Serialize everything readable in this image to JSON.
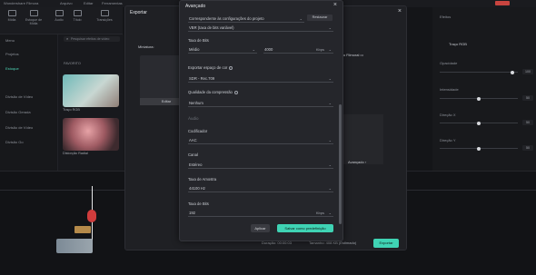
{
  "editor": {
    "menu": [
      "Wondershare Filmora",
      "Arquivo",
      "Editar",
      "Ferramentas"
    ],
    "tools": [
      "Mídia",
      "Estoque de Mídia",
      "Áudio",
      "Título",
      "Transições"
    ],
    "sidebar": [
      "Menu",
      "Projetos",
      "Estoque",
      "Divisão de Vídeo",
      "Divisão Gerada",
      "Divisão de Vídeo",
      "Divisão Go"
    ],
    "media_search_placeholder": "Pesquisar efeitos de vídeo",
    "media_badge": "FAVORITO",
    "thumbs": [
      {
        "label": "Traço RGB"
      },
      {
        "label": "Distorção Radial"
      }
    ],
    "right_panel": {
      "tab": "Efeitos",
      "toggle_label": "Traço RGB",
      "controls": [
        {
          "label": "Opacidade",
          "value": "100",
          "level": 0.95
        },
        {
          "label": "Intensidade",
          "value": "50",
          "level": 0.5
        },
        {
          "label": "Direção X",
          "value": "50",
          "level": 0.5
        },
        {
          "label": "Direção Y",
          "value": "50",
          "level": 0.5
        }
      ]
    }
  },
  "export": {
    "title": "Exportar",
    "thumbnail_label": "Miniatura:",
    "edit_label": "Editar",
    "right_field": "ultura Filmoral",
    "avancado": "Avançado",
    "duration": "Duração: 00:00:03",
    "size": "Tamanho: 408 KB (Estimado)",
    "export_button": "Exportar"
  },
  "advanced": {
    "title": "Avançado",
    "close": "×",
    "preset_value": "Correspondente às configurações do projeto",
    "restore_button": "Restaurar",
    "preset_sub": "VBR (taxa de bits variável)",
    "bitrate_label": "Taxa de Bits",
    "bitrate_quality": "Médio",
    "bitrate_value": "4000",
    "bitrate_unit": "Kbps",
    "color_space_label": "Exportar espaço de cor",
    "color_space_value": "SDR - Rec.709",
    "compression_label": "Qualidade da compressão",
    "compression_value": "Nenhum",
    "audio_section": "Áudio",
    "codec_label": "Codificador",
    "codec_value": "AAC",
    "channel_label": "Canal",
    "channel_value": "Estéreo",
    "samplerate_label": "Taxa de Amostra",
    "samplerate_value": "44100 Hz",
    "audio_bitrate_label": "Taxa de Bits",
    "audio_bitrate_value": "192",
    "audio_bitrate_unit": "Kbps",
    "apply_button": "Aplicar",
    "save_preset_button": "Salvar como predefinição"
  },
  "icons": [
    "close-icon",
    "chevron-down-icon",
    "info-icon",
    "folder-icon",
    "search-icon"
  ]
}
